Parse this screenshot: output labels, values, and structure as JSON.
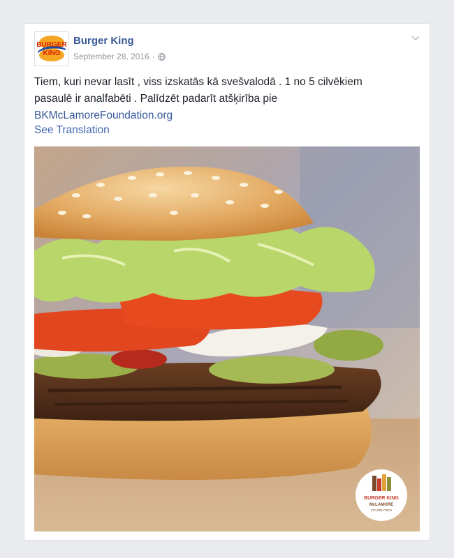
{
  "post": {
    "page_name": "Burger King",
    "date": "September 28, 2016",
    "separator": "·",
    "text_line1": "Tiem, kuri nevar lasīt , viss izskatās kā svešvalodā . 1 no 5 cilvēkiem",
    "text_line2": "pasaulē ir analfabēti . Palīdzēt padarīt atšķirība pie",
    "link_text": "BKMcLamoreFoundation.org",
    "see_translation": "See Translation"
  },
  "avatar_logo": {
    "line1": "BURGER",
    "line2": "KING"
  },
  "photo_badge": {
    "brand": "BURGER KING",
    "name": "McLAMORE",
    "sub": "FOUNDATION"
  },
  "icons": {
    "privacy": "globe-icon",
    "options": "chevron-down-icon"
  },
  "colors": {
    "link": "#365899",
    "accent": "#4267b2",
    "meta": "#90949c",
    "text": "#1d2129",
    "page_bg": "#e9ebee"
  }
}
